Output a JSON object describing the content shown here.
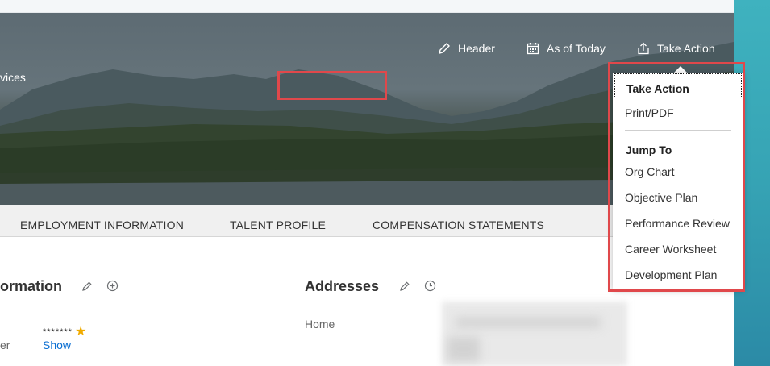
{
  "hero": {
    "partial_text": "vices",
    "actions": [
      {
        "label": "Header",
        "icon": "pencil-icon"
      },
      {
        "label": "As of Today",
        "icon": "calendar-icon"
      },
      {
        "label": "Take Action",
        "icon": "share-icon"
      }
    ]
  },
  "tabs": [
    "EMPLOYMENT INFORMATION",
    "TALENT PROFILE",
    "COMPENSATION STATEMENTS"
  ],
  "content": {
    "left_section_title": "ormation",
    "left_field_label": "er",
    "masked_value": "*******",
    "show_link": "Show",
    "addresses_title": "Addresses",
    "address_type": "Home"
  },
  "menu": {
    "title": "Take Action",
    "items_top": [
      "Print/PDF"
    ],
    "group_label": "Jump To",
    "items": [
      "Org Chart",
      "Objective Plan",
      "Performance Review",
      "Career Worksheet",
      "Development Plan"
    ]
  },
  "colors": {
    "highlight": "#e0484b",
    "link": "#0a6ed1",
    "star": "#f0ab00",
    "side_band": "#36a3b4"
  }
}
